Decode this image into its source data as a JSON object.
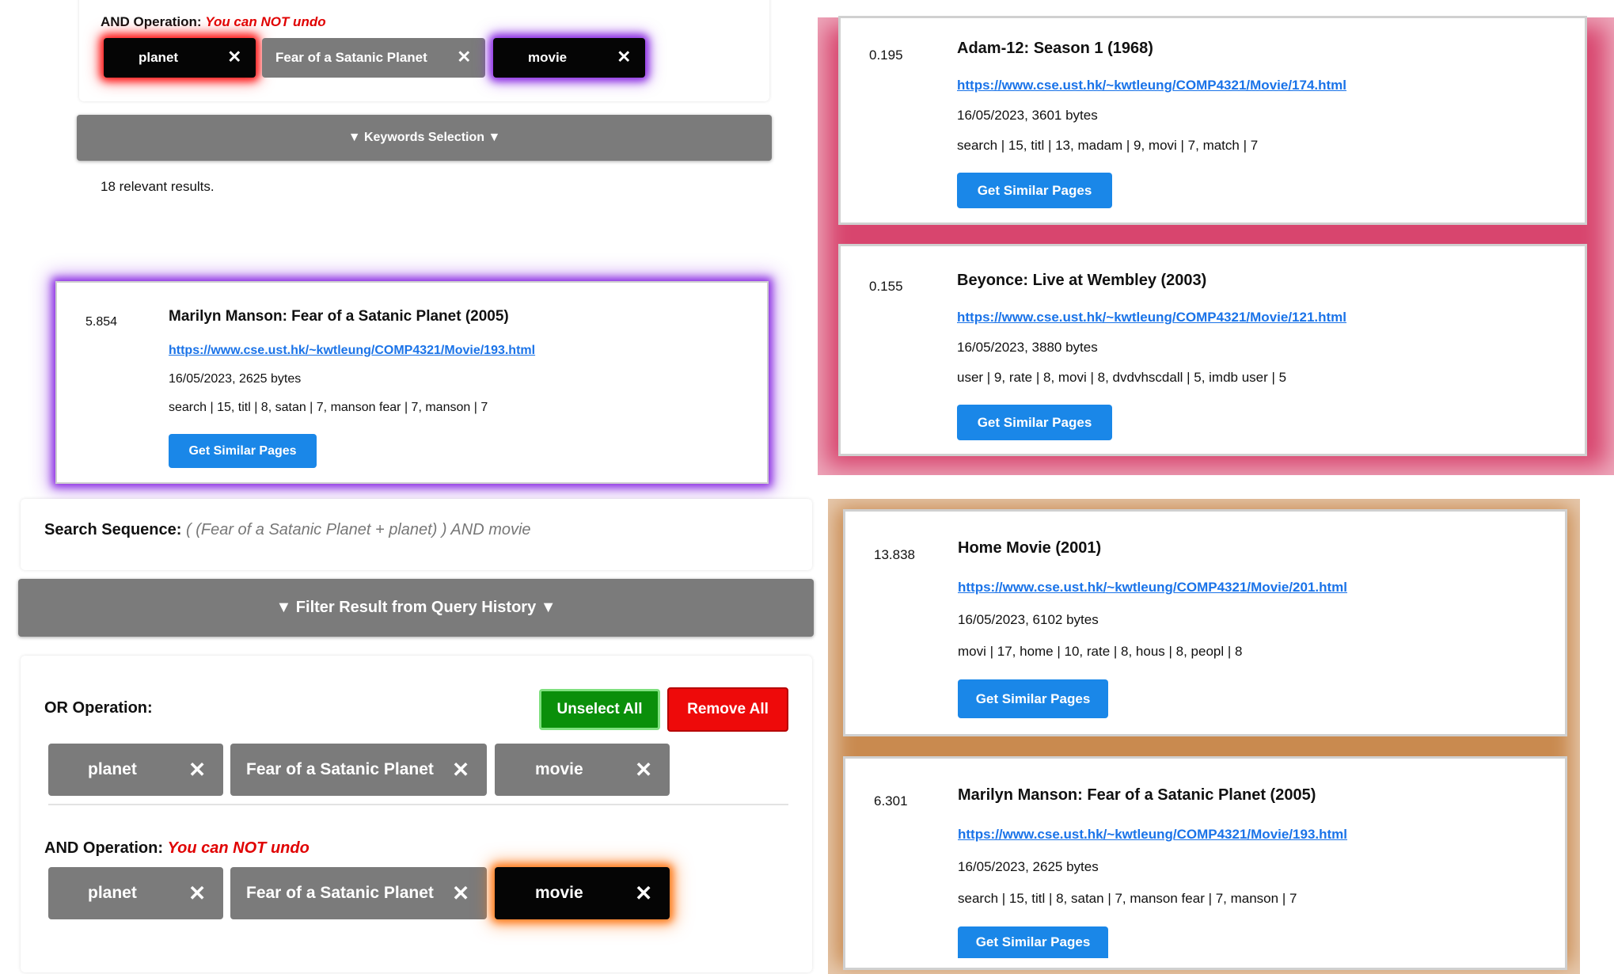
{
  "top_left": {
    "and_label": "AND Operation:",
    "and_warning": "You can NOT undo",
    "chips": [
      {
        "label": "planet",
        "close": "✕"
      },
      {
        "label": "Fear of a Satanic Planet",
        "close": "✕"
      },
      {
        "label": "movie",
        "close": "✕"
      }
    ],
    "keywords_bar": "▼ Keywords Selection ▼",
    "results_count": "18 relevant results."
  },
  "left_result": {
    "score": "5.854",
    "title": "Marilyn Manson: Fear of a Satanic Planet (2005)",
    "url": "https://www.cse.ust.hk/~kwtleung/COMP4321/Movie/193.html",
    "meta": "16/05/2023, 2625 bytes",
    "keywords": "search | 15, titl | 8, satan | 7, manson fear | 7, manson | 7",
    "button": "Get Similar Pages"
  },
  "bottom_left": {
    "sequence_label": "Search Sequence:",
    "sequence_value": "( (Fear of a Satanic Planet + planet) ) AND movie",
    "filter_bar": "▼ Filter Result from Query History ▼",
    "or_label": "OR Operation:",
    "unselect_all": "Unselect All",
    "remove_all": "Remove All",
    "or_chips": [
      {
        "label": "planet",
        "close": "✕"
      },
      {
        "label": "Fear of a Satanic Planet",
        "close": "✕"
      },
      {
        "label": "movie",
        "close": "✕"
      }
    ],
    "and_label": "AND Operation:",
    "and_warning": "You can NOT undo",
    "and_chips": [
      {
        "label": "planet",
        "close": "✕"
      },
      {
        "label": "Fear of a Satanic Planet",
        "close": "✕"
      },
      {
        "label": "movie",
        "close": "✕"
      }
    ]
  },
  "right_results": [
    {
      "score": "0.195",
      "title": "Adam-12: Season 1 (1968)",
      "url": "https://www.cse.ust.hk/~kwtleung/COMP4321/Movie/174.html",
      "meta": "16/05/2023, 3601 bytes",
      "keywords": "search | 15, titl | 13, madam | 9, movi | 7, match | 7",
      "button": "Get Similar Pages"
    },
    {
      "score": "0.155",
      "title": "Beyonce: Live at Wembley (2003)",
      "url": "https://www.cse.ust.hk/~kwtleung/COMP4321/Movie/121.html",
      "meta": "16/05/2023, 3880 bytes",
      "keywords": "user | 9, rate | 8, movi | 8, dvdvhscdall | 5, imdb user | 5",
      "button": "Get Similar Pages"
    },
    {
      "score": "13.838",
      "title": "Home Movie (2001)",
      "url": "https://www.cse.ust.hk/~kwtleung/COMP4321/Movie/201.html",
      "meta": "16/05/2023, 6102 bytes",
      "keywords": "movi | 17, home | 10, rate | 8, hous | 8, peopl | 8",
      "button": "Get Similar Pages"
    },
    {
      "score": "6.301",
      "title": "Marilyn Manson: Fear of a Satanic Planet (2005)",
      "url": "https://www.cse.ust.hk/~kwtleung/COMP4321/Movie/193.html",
      "meta": "16/05/2023, 2625 bytes",
      "keywords": "search | 15, titl | 8, satan | 7, manson fear | 7, manson | 7",
      "button": "Get Similar Pages"
    }
  ],
  "colors": {
    "chip_gray": "#7b7b7b",
    "chip_dark": "#050505",
    "glow_red": "#ff1a1a",
    "glow_purple": "#8a2be2",
    "glow_orange": "#ff7a1a",
    "frame_pink": "#d8456e",
    "frame_tan": "#c98a4f",
    "link_blue": "#1a73e8",
    "button_blue": "#1a87e8",
    "unselect_green": "#0a8f0a",
    "remove_red": "#ee0a0a"
  }
}
